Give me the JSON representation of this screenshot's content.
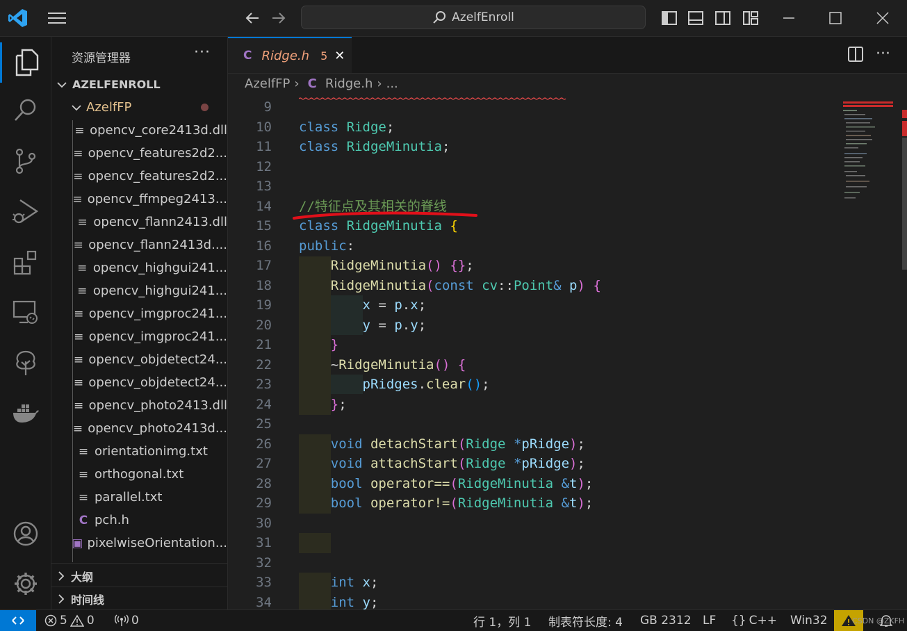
{
  "titlebar": {
    "search_text": "AzelfEnroll",
    "colors": {
      "vscode_blue": "#0078d4"
    },
    "icons": [
      "vscode-logo-icon",
      "menu-icon",
      "back-arrow-icon",
      "forward-arrow-icon",
      "search-icon",
      "toggle-primary-sidebar-icon",
      "toggle-panel-icon",
      "toggle-secondary-sidebar-icon",
      "customize-layout-icon",
      "minimize-icon",
      "maximize-icon",
      "close-icon"
    ]
  },
  "activity_bar": {
    "items": [
      "explorer-icon",
      "search-icon",
      "source-control-icon",
      "run-debug-icon",
      "extensions-icon",
      "remote-explorer-icon",
      "git-tree-icon",
      "docker-icon"
    ],
    "bottom": [
      "accounts-icon",
      "manage-gear-icon"
    ]
  },
  "sidebar": {
    "title": "资源管理器",
    "more": "···",
    "root": "AZELFENROLL",
    "folder": "AzelfFP",
    "files": [
      {
        "name": "opencv_core2413d.dll",
        "icon": "≡"
      },
      {
        "name": "opencv_features2d2...",
        "icon": "≡"
      },
      {
        "name": "opencv_features2d2...",
        "icon": "≡"
      },
      {
        "name": "opencv_ffmpeg2413...",
        "icon": "≡"
      },
      {
        "name": "opencv_flann2413.dll",
        "icon": "≡"
      },
      {
        "name": "opencv_flann2413d....",
        "icon": "≡"
      },
      {
        "name": "opencv_highgui241...",
        "icon": "≡"
      },
      {
        "name": "opencv_highgui241...",
        "icon": "≡"
      },
      {
        "name": "opencv_imgproc241...",
        "icon": "≡"
      },
      {
        "name": "opencv_imgproc241...",
        "icon": "≡"
      },
      {
        "name": "opencv_objdetect24...",
        "icon": "≡"
      },
      {
        "name": "opencv_objdetect24...",
        "icon": "≡"
      },
      {
        "name": "opencv_photo2413.dll",
        "icon": "≡"
      },
      {
        "name": "opencv_photo2413d...",
        "icon": "≡"
      },
      {
        "name": "orientationimg.txt",
        "icon": "≡"
      },
      {
        "name": "orthogonal.txt",
        "icon": "≡"
      },
      {
        "name": "parallel.txt",
        "icon": "≡"
      },
      {
        "name": "pch.h",
        "icon": "C"
      },
      {
        "name": "pixelwiseOrientation...",
        "icon": "▣"
      }
    ],
    "sections": [
      "大纲",
      "时间线"
    ]
  },
  "editor": {
    "tab": {
      "icon": "C",
      "label": "Ridge.h",
      "badge": "5",
      "close": "✕"
    },
    "breadcrumb": {
      "folder": "AzelfFP",
      "sep": "›",
      "icon": "C",
      "file": "Ridge.h",
      "more": "..."
    },
    "first_line": 9
  },
  "status_bar": {
    "remote_icon": "remote-indicator-icon",
    "errors": "5",
    "warnings": "0",
    "ports": "0",
    "position": "行 1，列 1",
    "tab_size": "制表符长度: 4",
    "encoding": "GB 2312",
    "eol": "LF",
    "language": "C++",
    "platform": "Win32",
    "watermark": "CSDN @ZKFH"
  }
}
